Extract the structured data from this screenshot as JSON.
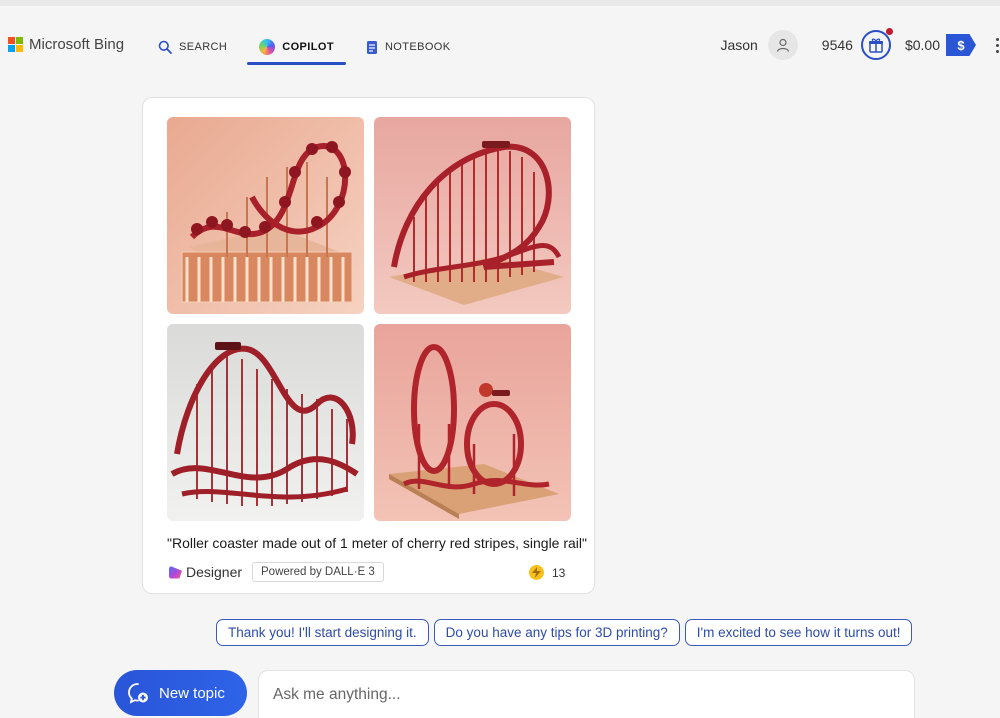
{
  "header": {
    "brand": "Microsoft Bing",
    "brand_colors": [
      "#f25022",
      "#7fba00",
      "#00a4ef",
      "#ffb900"
    ],
    "nav": [
      {
        "label": "SEARCH",
        "icon": "search-icon"
      },
      {
        "label": "COPILOT",
        "icon": "copilot-icon",
        "active": true
      },
      {
        "label": "NOTEBOOK",
        "icon": "notebook-icon"
      }
    ],
    "user_name": "Jason",
    "points": "9546",
    "balance": "$0.00",
    "balance_badge": "$"
  },
  "card": {
    "images": [
      {
        "name": "cherry-coaster-1"
      },
      {
        "name": "cherry-coaster-2"
      },
      {
        "name": "cherry-coaster-3"
      },
      {
        "name": "cherry-coaster-4"
      }
    ],
    "caption": "\"Roller coaster made out of 1 meter of cherry red stripes, single rail\"",
    "designer_label": "Designer",
    "powered_by": "Powered by DALL·E 3",
    "boost_count": "13"
  },
  "suggestions": [
    "Thank you! I'll start designing it.",
    "Do you have any tips for 3D printing?",
    "I'm excited to see how it turns out!"
  ],
  "composer": {
    "new_topic_label": "New topic",
    "placeholder": "Ask me anything..."
  },
  "colors": {
    "accent": "#2a4fc4",
    "coaster_red": "#b5262c",
    "background": "#f5f5f5"
  }
}
